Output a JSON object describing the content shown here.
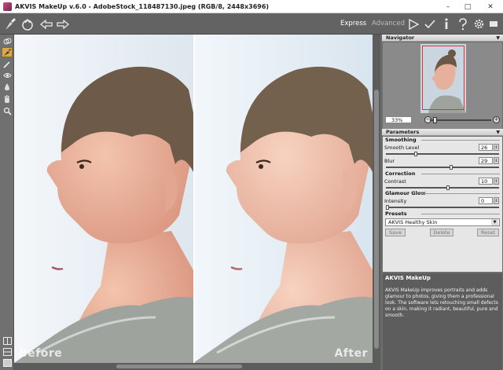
{
  "window": {
    "title": "AKVIS MakeUp v.6.0 - AdobeStock_118487130.jpeg (RGB/8, 2448x3696)",
    "minimize_glyph": "–",
    "maximize_glyph": "□",
    "close_glyph": "✕"
  },
  "toolbar": {
    "mode_express": "Express",
    "mode_advanced": "Advanced",
    "icons": [
      "brush-logo-icon",
      "open-image-icon",
      "undo-arrow-icon",
      "redo-arrow-icon",
      "run-icon",
      "apply-check-icon",
      "info-icon",
      "help-icon",
      "settings-gear-icon",
      "screen-icon"
    ]
  },
  "left_tools": [
    "before-after-icon",
    "brush-tool-icon",
    "pencil-tool-icon",
    "eye-tool-icon",
    "drop-tool-icon",
    "hand-tool-icon",
    "zoom-tool-icon"
  ],
  "canvas": {
    "before_label": "Before",
    "after_label": "After"
  },
  "navigator": {
    "header": "Navigator",
    "zoom_value": "33%",
    "zoom_out_glyph": "−",
    "zoom_in_glyph": "+"
  },
  "parameters": {
    "header": "Parameters",
    "smoothing_label": "Smoothing",
    "smooth_level_label": "Smooth Level",
    "smooth_level_value": "26",
    "smooth_level_fraction": 0.26,
    "blur_label": "Blur",
    "blur_value": "29",
    "blur_fraction": 0.58,
    "correction_label": "Correction",
    "contrast_label": "Contrast",
    "contrast_value": "10",
    "contrast_fraction": 0.55,
    "glamour_label": "Glamour Glow",
    "intensity_label": "Intensity",
    "intensity_value": "0",
    "intensity_fraction": 0.0
  },
  "presets": {
    "label": "Presets",
    "selected": "AKVIS Healthy Skin",
    "save_label": "Save",
    "delete_label": "Delete",
    "reset_label": "Reset"
  },
  "help": {
    "title": "AKVIS MakeUp",
    "body": "AKVIS MakeUp improves portraits and adds glamour to photos, giving them a professional look. The software lets retouching small defects on a skin, making it radiant, beautiful, pure and smooth."
  },
  "colors": {
    "toolbar_bg": "#636363",
    "panel_bg": "#6e6e6e",
    "active_tool": "#d9a84a",
    "navigator_frame": "#e03030"
  }
}
